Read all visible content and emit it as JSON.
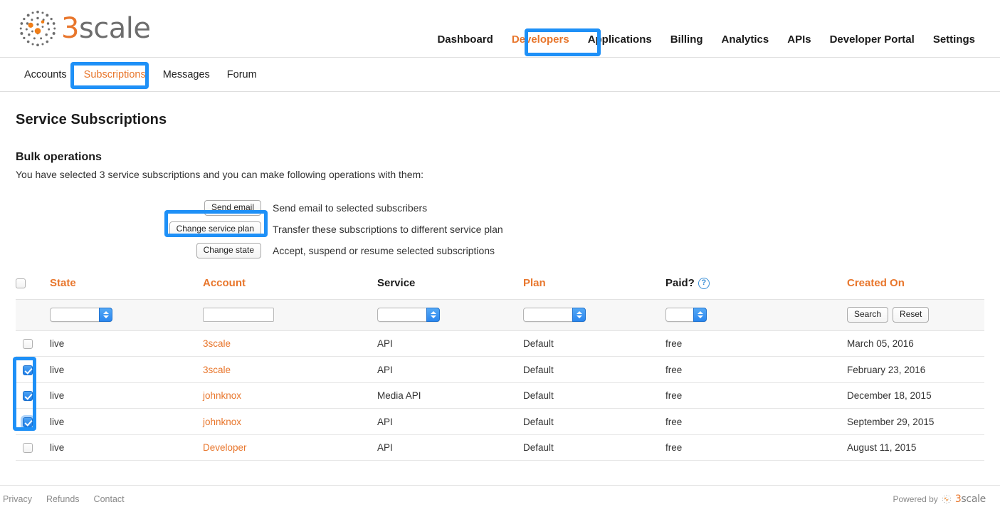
{
  "brand": {
    "logo_icon": "3scale-dots-logo-icon",
    "name_prefix": "3",
    "name_suffix": "scale"
  },
  "topnav": {
    "items": [
      {
        "label": "Dashboard",
        "active": false
      },
      {
        "label": "Developers",
        "active": true
      },
      {
        "label": "Applications",
        "active": false
      },
      {
        "label": "Billing",
        "active": false
      },
      {
        "label": "Analytics",
        "active": false
      },
      {
        "label": "APIs",
        "active": false
      },
      {
        "label": "Developer Portal",
        "active": false
      },
      {
        "label": "Settings",
        "active": false
      }
    ]
  },
  "subnav": {
    "items": [
      {
        "label": "Accounts",
        "active": false
      },
      {
        "label": "Subscriptions",
        "active": true
      },
      {
        "label": "Messages",
        "active": false
      },
      {
        "label": "Forum",
        "active": false
      }
    ]
  },
  "page": {
    "title": "Service Subscriptions",
    "bulk_title": "Bulk operations",
    "bulk_description": "You have selected 3 service subscriptions and you can make following operations with them:"
  },
  "bulk_operations": [
    {
      "button": "Send email",
      "description": "Send email to selected subscribers"
    },
    {
      "button": "Change service plan",
      "description": "Transfer these subscriptions to different service plan"
    },
    {
      "button": "Change state",
      "description": "Accept, suspend or resume selected subscriptions"
    }
  ],
  "table": {
    "headers": {
      "state": "State",
      "account": "Account",
      "service": "Service",
      "plan": "Plan",
      "paid": "Paid?",
      "paid_help_icon": "question-mark-help-icon",
      "created_on": "Created On"
    },
    "filters": {
      "state_value": "",
      "account_value": "",
      "account_placeholder": "",
      "service_value": "",
      "plan_value": "",
      "paid_value": "",
      "search_label": "Search",
      "reset_label": "Reset"
    },
    "rows": [
      {
        "checked": false,
        "focus": false,
        "state": "live",
        "account": "3scale",
        "service": "API",
        "plan": "Default",
        "paid": "free",
        "created_on": "March 05, 2016"
      },
      {
        "checked": true,
        "focus": false,
        "state": "live",
        "account": "3scale",
        "service": "API",
        "plan": "Default",
        "paid": "free",
        "created_on": "February 23, 2016"
      },
      {
        "checked": true,
        "focus": false,
        "state": "live",
        "account": "johnknox",
        "service": "Media API",
        "plan": "Default",
        "paid": "free",
        "created_on": "December 18, 2015"
      },
      {
        "checked": true,
        "focus": true,
        "state": "live",
        "account": "johnknox",
        "service": "API",
        "plan": "Default",
        "paid": "free",
        "created_on": "September 29, 2015"
      },
      {
        "checked": false,
        "focus": false,
        "state": "live",
        "account": "Developer",
        "service": "API",
        "plan": "Default",
        "paid": "free",
        "created_on": "August 11, 2015"
      }
    ],
    "select_all_checked": false
  },
  "footer": {
    "links": [
      "Privacy",
      "Refunds",
      "Contact"
    ],
    "powered_by": "Powered by",
    "powered_brand_prefix": "3",
    "powered_brand_suffix": "scale"
  },
  "annotations": {
    "highlight_color": "#1E90F7",
    "targets": [
      "Developers",
      "Subscriptions",
      "Change service plan",
      "row-checkboxes"
    ]
  },
  "colors": {
    "accent_orange": "#E8762C",
    "annotation_blue": "#1E90F7",
    "text_dark": "#1a1a1a"
  }
}
